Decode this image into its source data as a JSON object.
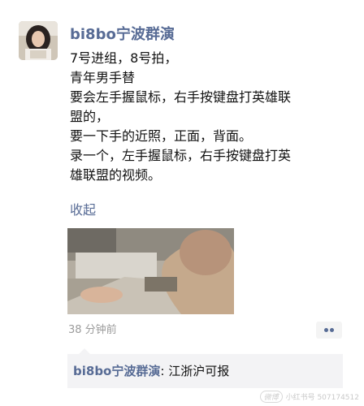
{
  "post": {
    "author": "bi8bo宁波群演",
    "lines": [
      "7号进组，8号拍，",
      "青年男手替",
      "要会左手握鼠标，右手按键盘打英雄联",
      "盟的，",
      "要一下手的近照，正面，背面。",
      "录一个，左手握鼠标，右手按键盘打英",
      "雄联盟的视频。"
    ],
    "collapse_label": "收起",
    "time": "38 分钟前"
  },
  "comment": {
    "author": "bi8bo宁波群演",
    "separator": ": ",
    "text": "江浙沪可报"
  },
  "watermark": {
    "logo": "微博",
    "text": "小红书号 507174512"
  },
  "colors": {
    "link": "#576b95",
    "text": "#111111",
    "muted": "#9b9b9b",
    "comment_bg": "#f3f3f5"
  }
}
